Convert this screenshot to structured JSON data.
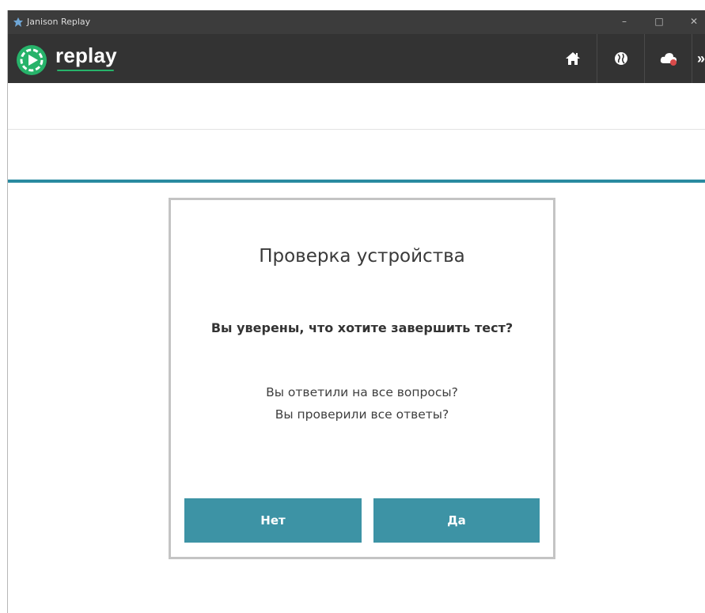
{
  "window": {
    "title": "Janison Replay",
    "minimize_glyph": "–",
    "maximize_glyph": "□",
    "close_glyph": "✕"
  },
  "header": {
    "logo_text": "replay",
    "brand_color": "#27b36a",
    "more_glyph": "»",
    "nav_icons": [
      "home-icon",
      "globe-icon",
      "cloud-icon"
    ]
  },
  "colors": {
    "accent": "#2a8aa0",
    "button": "#3d93a5",
    "header_bg": "#333333"
  },
  "dialog": {
    "title": "Проверка устройства",
    "question": "Вы уверены, что хотите завершить тест?",
    "line1": "Вы ответили на все вопросы?",
    "line2": "Вы проверили все ответы?",
    "no_label": "Нет",
    "yes_label": "Да"
  }
}
